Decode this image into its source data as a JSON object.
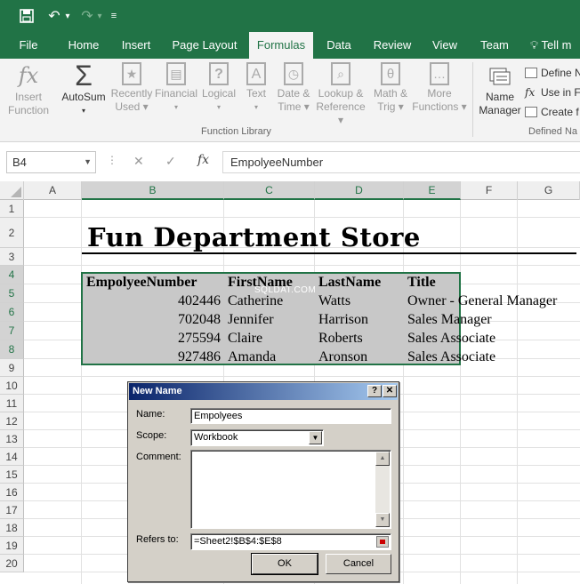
{
  "titlebar": {
    "save_icon": "save-icon",
    "undo_icon": "undo-icon",
    "redo_icon": "redo-icon",
    "customize_icon": "customize-qat-icon",
    "undo_glyph": "↶",
    "redo_glyph": "↷",
    "dropdown_glyph": "▾",
    "customize_glyph": "≡"
  },
  "tabs": [
    "File",
    "Home",
    "Insert",
    "Page Layout",
    "Formulas",
    "Data",
    "Review",
    "View",
    "Team",
    "Tell m"
  ],
  "active_tab": "Formulas",
  "ribbon": {
    "function_library": {
      "label": "Function Library",
      "buttons": [
        {
          "line1": "Insert",
          "line2": "Function",
          "icon": "fx-icon",
          "glyph": "fx"
        },
        {
          "line1": "AutoSum",
          "line2": "▾",
          "icon": "sigma-icon",
          "glyph": "Σ"
        },
        {
          "line1": "Recently",
          "line2": "Used ▾",
          "icon": "star-icon",
          "glyph": "★"
        },
        {
          "line1": "Financial",
          "line2": "▾",
          "icon": "financial-icon",
          "glyph": "▤"
        },
        {
          "line1": "Logical",
          "line2": "▾",
          "icon": "logical-icon",
          "glyph": "?"
        },
        {
          "line1": "Text",
          "line2": "▾",
          "icon": "text-icon",
          "glyph": "A"
        },
        {
          "line1": "Date &",
          "line2": "Time ▾",
          "icon": "date-time-icon",
          "glyph": "◷"
        },
        {
          "line1": "Lookup &",
          "line2": "Reference ▾",
          "icon": "lookup-icon",
          "glyph": "⌕"
        },
        {
          "line1": "Math &",
          "line2": "Trig ▾",
          "icon": "math-icon",
          "glyph": "θ"
        },
        {
          "line1": "More",
          "line2": "Functions ▾",
          "icon": "more-functions-icon",
          "glyph": "…"
        }
      ]
    },
    "defined_names": {
      "label": "Defined Na",
      "name_manager": {
        "line1": "Name",
        "line2": "Manager",
        "icon": "name-manager-icon"
      },
      "items": [
        "Define N",
        "Use in F",
        "Create f"
      ]
    }
  },
  "formula_bar": {
    "name_box": "B4",
    "cancel_glyph": "✕",
    "enter_glyph": "✓",
    "fx": "fx",
    "content": "EmpolyeeNumber"
  },
  "grid": {
    "columns": [
      "A",
      "B",
      "C",
      "D",
      "E",
      "F",
      "G"
    ],
    "rows": [
      "1",
      "2",
      "3",
      "4",
      "5",
      "6",
      "7",
      "8",
      "9",
      "10",
      "11",
      "12",
      "13",
      "14",
      "15",
      "16",
      "17",
      "18",
      "19",
      "20"
    ],
    "title": "Fun Department Store",
    "headers": [
      "EmpolyeeNumber",
      "FirstName",
      "LastName",
      "Title"
    ],
    "records": [
      [
        "402446",
        "Catherine",
        "Watts",
        "Owner - General Manager"
      ],
      [
        "702048",
        "Jennifer",
        "Harrison",
        "Sales Manager"
      ],
      [
        "275594",
        "Claire",
        "Roberts",
        "Sales Associate"
      ],
      [
        "927486",
        "Amanda",
        "Aronson",
        "Sales Associate"
      ]
    ],
    "watermark": "SQLDAT.COM"
  },
  "dialog": {
    "title": "New Name",
    "help_glyph": "?",
    "close_glyph": "✕",
    "name_label": "Name:",
    "name_value": "Empolyees",
    "scope_label": "Scope:",
    "scope_value": "Workbook",
    "comment_label": "Comment:",
    "refers_label": "Refers to:",
    "refers_value": "=Sheet2!$B$4:$E$8",
    "ok": "OK",
    "cancel": "Cancel"
  },
  "colors": {
    "excel_green": "#217346",
    "dialog_face": "#d4d0c8",
    "dialog_title_start": "#0a246a",
    "selection_fill": "#c8c8c8"
  }
}
